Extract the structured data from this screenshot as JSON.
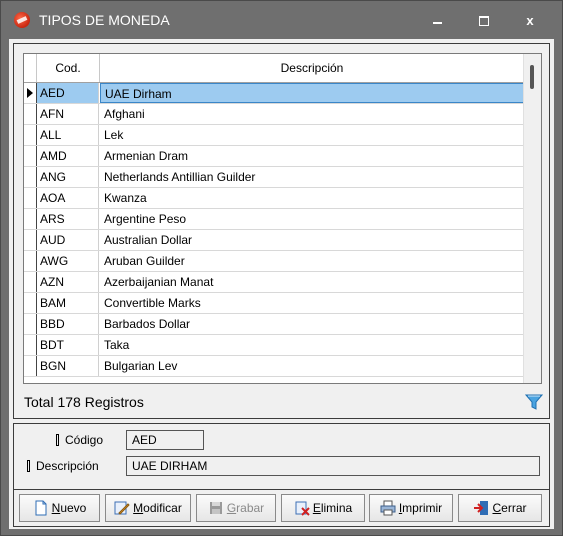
{
  "window": {
    "title": "TIPOS DE MONEDA",
    "minimize": "–",
    "maximize": "□",
    "close": "x"
  },
  "grid": {
    "columns": [
      "Cod.",
      "Descripción"
    ],
    "rows": [
      {
        "cod": "AED",
        "desc": "UAE Dirham"
      },
      {
        "cod": "AFN",
        "desc": "Afghani"
      },
      {
        "cod": "ALL",
        "desc": "Lek"
      },
      {
        "cod": "AMD",
        "desc": "Armenian Dram"
      },
      {
        "cod": "ANG",
        "desc": "Netherlands Antillian Guilder"
      },
      {
        "cod": "AOA",
        "desc": "Kwanza"
      },
      {
        "cod": "ARS",
        "desc": "Argentine Peso"
      },
      {
        "cod": "AUD",
        "desc": "Australian Dollar"
      },
      {
        "cod": "AWG",
        "desc": "Aruban Guilder"
      },
      {
        "cod": "AZN",
        "desc": "Azerbaijanian Manat"
      },
      {
        "cod": "BAM",
        "desc": "Convertible Marks"
      },
      {
        "cod": "BBD",
        "desc": "Barbados Dollar"
      },
      {
        "cod": "BDT",
        "desc": "Taka"
      },
      {
        "cod": "BGN",
        "desc": "Bulgarian Lev"
      }
    ],
    "selected_index": 0
  },
  "status": {
    "total": "Total 178 Registros",
    "filter_icon": "filter-icon"
  },
  "form": {
    "codigo_label": "Código",
    "codigo_value": "AED",
    "descripcion_label": "Descripción",
    "descripcion_value": "UAE DIRHAM"
  },
  "buttons": {
    "nuevo_u": "N",
    "nuevo_rest": "uevo",
    "modificar_u": "M",
    "modificar_rest": "odificar",
    "grabar_u": "G",
    "grabar_rest": "rabar",
    "elimina_u": "E",
    "elimina_rest": "limina",
    "imprimir_u": "I",
    "imprimir_rest": "mprimir",
    "cerrar_u": "C",
    "cerrar_rest": "errar"
  },
  "colors": {
    "selection": "#9dcbf0",
    "titlebar": "#6f6f6f",
    "app_icon": "#d93a1f"
  }
}
